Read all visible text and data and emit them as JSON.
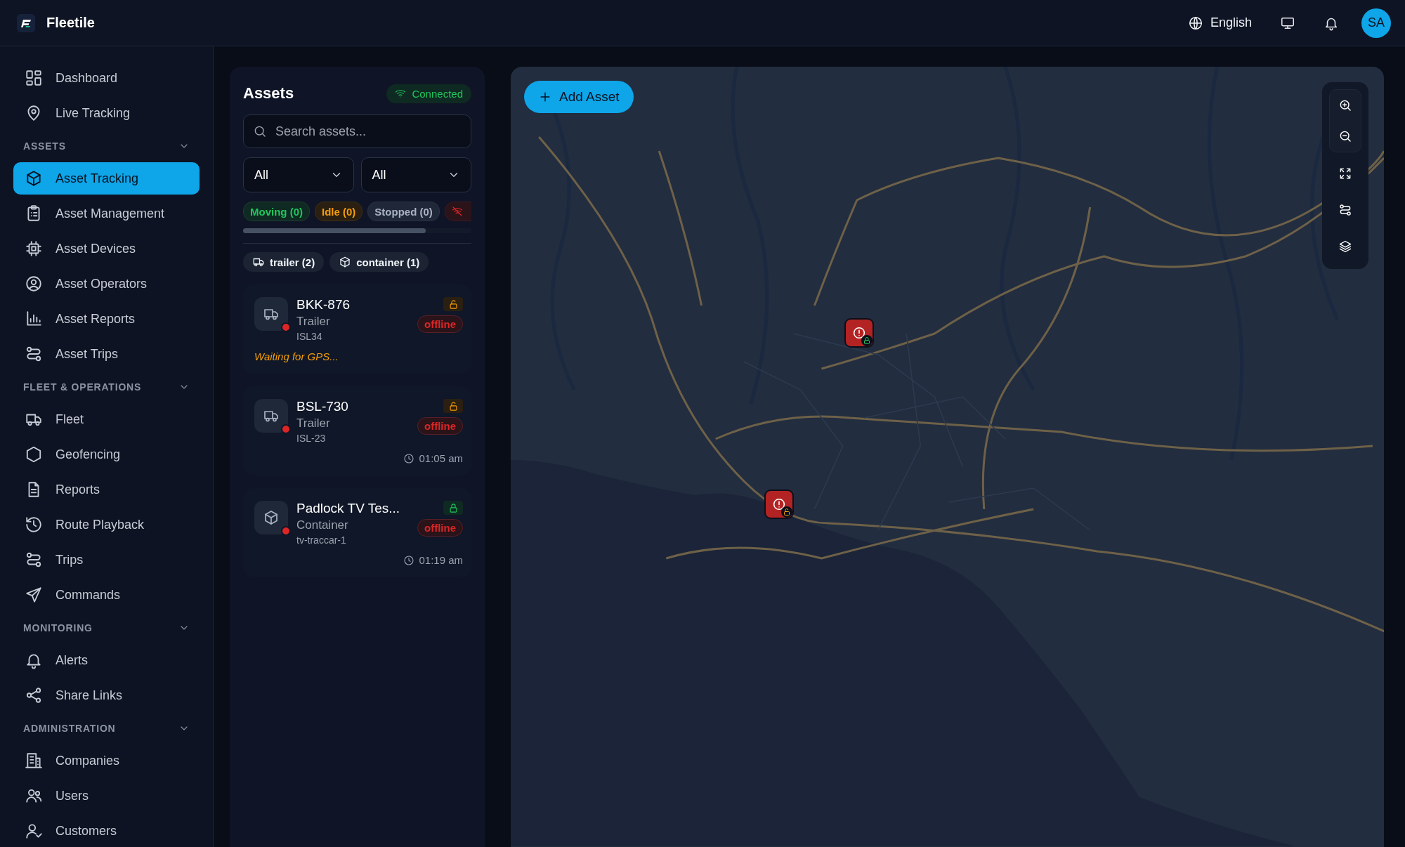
{
  "header": {
    "brand": "Fleetile",
    "language": "English",
    "avatar": "SA"
  },
  "sidebar": {
    "sections": [
      {
        "items": [
          {
            "label": "Dashboard",
            "selected": false
          },
          {
            "label": "Live Tracking",
            "selected": false
          }
        ]
      },
      {
        "title": "ASSETS",
        "expanded": true,
        "items": [
          {
            "label": "Asset Tracking",
            "selected": true
          },
          {
            "label": "Asset Management",
            "selected": false
          },
          {
            "label": "Asset Devices",
            "selected": false
          },
          {
            "label": "Asset Operators",
            "selected": false
          },
          {
            "label": "Asset Reports",
            "selected": false
          },
          {
            "label": "Asset Trips",
            "selected": false
          }
        ]
      },
      {
        "title": "FLEET & OPERATIONS",
        "expanded": true,
        "items": [
          {
            "label": "Fleet",
            "selected": false
          },
          {
            "label": "Geofencing",
            "selected": false
          },
          {
            "label": "Reports",
            "selected": false
          },
          {
            "label": "Route Playback",
            "selected": false
          },
          {
            "label": "Trips",
            "selected": false
          },
          {
            "label": "Commands",
            "selected": false
          }
        ]
      },
      {
        "title": "MONITORING",
        "expanded": true,
        "items": [
          {
            "label": "Alerts",
            "selected": false
          },
          {
            "label": "Share Links",
            "selected": false
          }
        ]
      },
      {
        "title": "ADMINISTRATION",
        "expanded": true,
        "items": [
          {
            "label": "Companies",
            "selected": false
          },
          {
            "label": "Users",
            "selected": false
          },
          {
            "label": "Customers",
            "selected": false
          }
        ]
      }
    ]
  },
  "assets": {
    "title": "Assets",
    "connection": "Connected",
    "search": {
      "placeholder": "Search assets..."
    },
    "selects": [
      {
        "value": "All"
      },
      {
        "value": "All"
      }
    ],
    "status_chips": [
      {
        "kind": "moving",
        "label": "Moving (0)"
      },
      {
        "kind": "idle",
        "label": "Idle (0)"
      },
      {
        "kind": "stopped",
        "label": "Stopped (0)"
      },
      {
        "kind": "offline"
      }
    ],
    "type_chips": [
      {
        "kind": "trailer",
        "label": "trailer (2)"
      },
      {
        "kind": "container",
        "label": "container (1)"
      }
    ],
    "items": [
      {
        "kind": "trailer",
        "name": "BKK-876",
        "type": "Trailer",
        "device": "ISL34",
        "status": "offline",
        "online": false,
        "locked": false,
        "note": "Waiting for GPS..."
      },
      {
        "kind": "trailer",
        "name": "BSL-730",
        "type": "Trailer",
        "device": "ISL-23",
        "status": "offline",
        "online": false,
        "locked": false,
        "time": "01:05 am"
      },
      {
        "kind": "container",
        "name": "Padlock TV Tes...",
        "type": "Container",
        "device": "tv-traccar-1",
        "status": "offline",
        "online": false,
        "locked": true,
        "time": "01:19 am"
      }
    ]
  },
  "map": {
    "add_button": "Add Asset",
    "markers": [
      {
        "locked": true
      },
      {
        "locked": false
      }
    ]
  }
}
